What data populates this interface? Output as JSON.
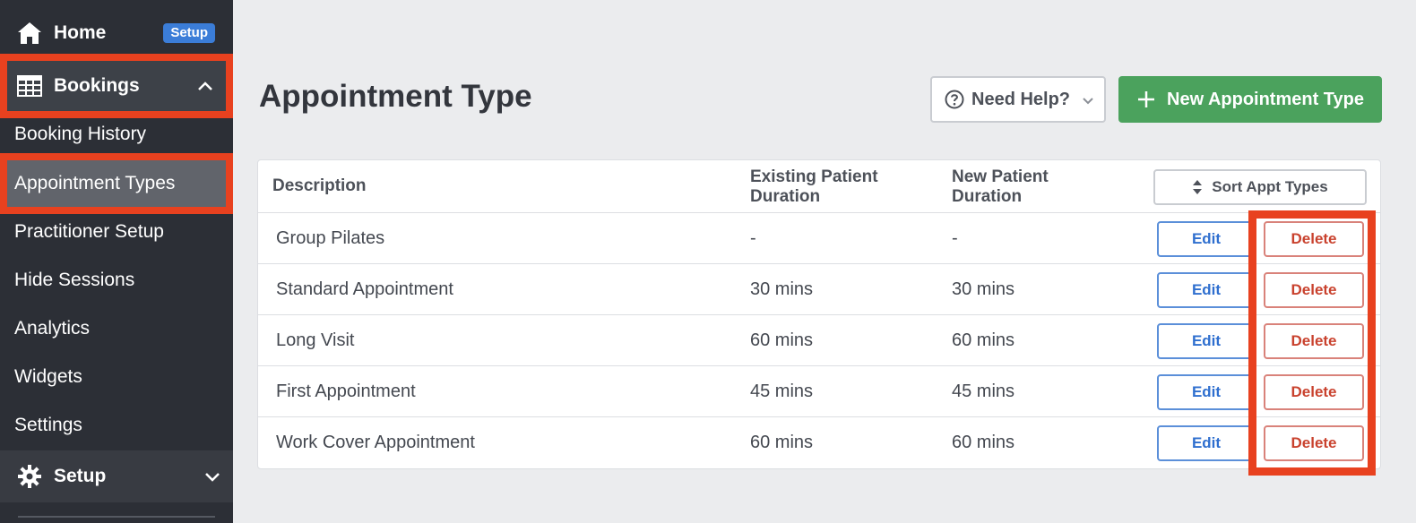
{
  "sidebar": {
    "home_label": "Home",
    "setup_badge": "Setup",
    "bookings_label": "Bookings",
    "sub_items": [
      {
        "label": "Booking History"
      },
      {
        "label": "Appointment Types"
      },
      {
        "label": "Practitioner Setup"
      },
      {
        "label": "Hide Sessions"
      },
      {
        "label": "Analytics"
      },
      {
        "label": "Widgets"
      },
      {
        "label": "Settings"
      }
    ],
    "setup_label": "Setup"
  },
  "header": {
    "title": "Appointment Type",
    "help_label": "Need Help?",
    "new_label": "New Appointment Type"
  },
  "table": {
    "col_description": "Description",
    "col_existing_1": "Existing Patient",
    "col_existing_2": "Duration",
    "col_new_1": "New Patient",
    "col_new_2": "Duration",
    "sort_label": "Sort Appt Types",
    "edit_label": "Edit",
    "delete_label": "Delete",
    "rows": [
      {
        "description": "Group Pilates",
        "existing": "-",
        "new": "-"
      },
      {
        "description": "Standard Appointment",
        "existing": "30 mins",
        "new": "30 mins"
      },
      {
        "description": "Long Visit",
        "existing": "60 mins",
        "new": "60 mins"
      },
      {
        "description": "First Appointment",
        "existing": "45 mins",
        "new": "45 mins"
      },
      {
        "description": "Work Cover Appointment",
        "existing": "60 mins",
        "new": "60 mins"
      }
    ]
  },
  "colors": {
    "sidebar_bg": "#2c2f36",
    "highlight": "#e8411f",
    "primary_green": "#4ba25d",
    "edit_blue": "#2f6fcf",
    "delete_red": "#c9422e"
  }
}
